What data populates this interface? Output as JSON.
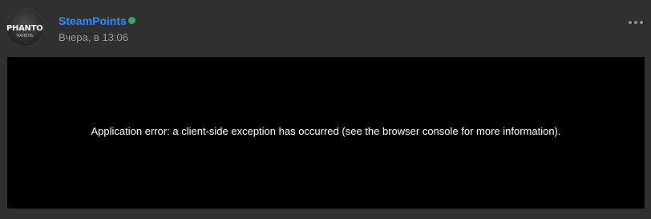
{
  "post": {
    "author": {
      "avatar_logo": "PHANTOM",
      "avatar_sub": "ПАНЕЛЬ",
      "name": "SteamPoints",
      "status": "online",
      "status_color": "#3ba55d",
      "name_color": "#2f8cff"
    },
    "timestamp": "Вчера, в 13:06",
    "menu_icon": "more-horizontal-icon",
    "content": {
      "message": "Application error: a client-side exception has occurred (see the browser console for more information)."
    }
  }
}
